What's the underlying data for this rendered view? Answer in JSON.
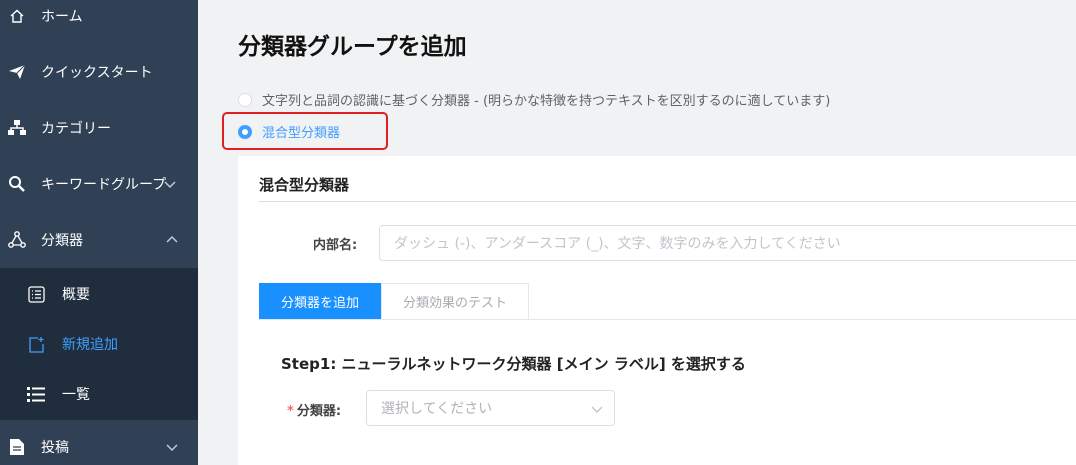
{
  "sidebar": {
    "items": [
      {
        "label": "ホーム",
        "icon": "home-icon"
      },
      {
        "label": "クイックスタート",
        "icon": "paper-plane-icon"
      },
      {
        "label": "カテゴリー",
        "icon": "sitemap-icon"
      },
      {
        "label": "キーワードグループ",
        "icon": "key-search-icon"
      },
      {
        "label": "分類器",
        "icon": "nodes-icon"
      },
      {
        "label": "投稿",
        "icon": "document-icon"
      }
    ],
    "submenu": [
      {
        "label": "概要",
        "icon": "list-box-icon"
      },
      {
        "label": "新規追加",
        "icon": "new-page-icon"
      },
      {
        "label": "一覧",
        "icon": "list-icon"
      }
    ]
  },
  "main": {
    "title": "分類器グループを追加",
    "radio_options": [
      {
        "label": "文字列と品詞の認識に基づく分類器 - (明らかな特徴を持つテキストを区別するのに適しています)",
        "checked": false
      },
      {
        "label": "混合型分類器",
        "checked": true
      }
    ],
    "card": {
      "title": "混合型分類器",
      "internal_name_label": "内部名:",
      "internal_name_placeholder": "ダッシュ (-)、アンダースコア (_)、文字、数字のみを入力してください",
      "internal_name_value": "",
      "tabs": [
        {
          "label": "分類器を追加",
          "active": true
        },
        {
          "label": "分類効果のテスト",
          "active": false
        }
      ],
      "step_title": "Step1: ニューラルネットワーク分類器 [メイン ラベル] を選択する",
      "classifier_label": "分類器:",
      "classifier_placeholder": "選択してください"
    }
  },
  "colors": {
    "sidebar_bg": "#304156",
    "submenu_bg": "#1f2d3d",
    "accent": "#409eff",
    "tab_active": "#1890ff",
    "highlight": "#e02020"
  }
}
